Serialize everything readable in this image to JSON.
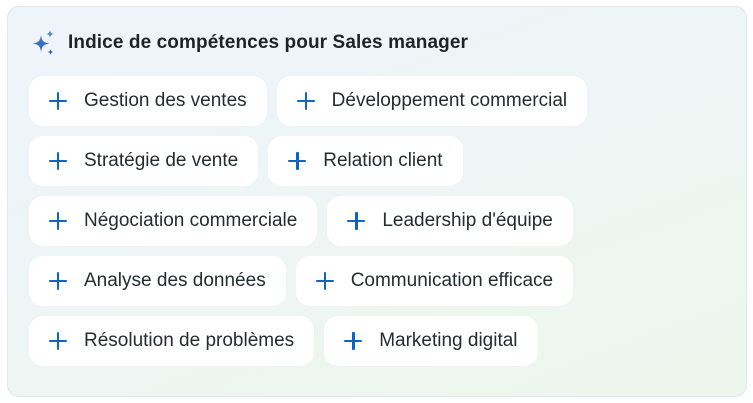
{
  "header": {
    "title": "Indice de compétences pour Sales manager",
    "icon": "sparkle-icon"
  },
  "colors": {
    "accent": "#0a66c2",
    "text": "#262b30",
    "chip_background": "#ffffff"
  },
  "chips": [
    [
      "Gestion des ventes",
      "Développement commercial"
    ],
    [
      "Stratégie de vente",
      "Relation client"
    ],
    [
      "Négociation commerciale",
      "Leadership d'équipe"
    ],
    [
      "Analyse des données",
      "Communication efficace"
    ],
    [
      "Résolution de problèmes",
      "Marketing digital"
    ]
  ]
}
